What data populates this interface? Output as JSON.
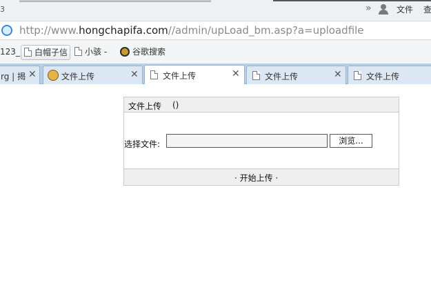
{
  "titlebar": {
    "left_text": "3",
    "overflow_chevron": "»",
    "menu_file": "文件",
    "menu_view": "查"
  },
  "address": {
    "prefix": "http://www.",
    "domain": "hongchapifa.com",
    "path": "//admin/upLoad_bm.asp?a=uploadfile"
  },
  "bookmarks": {
    "leading": "123_",
    "items": [
      {
        "label": "白帽子信",
        "icon": "page-icon"
      },
      {
        "label": "小骇 -",
        "icon": "page-icon"
      },
      {
        "label": "谷歌搜索",
        "icon": "paw-icon"
      }
    ]
  },
  "tabs": [
    {
      "label": "rg | 揭",
      "icon": "",
      "active": false
    },
    {
      "label": "文件上传",
      "icon": "face-icon",
      "active": false
    },
    {
      "label": "文件上传",
      "icon": "page-icon",
      "active": true
    },
    {
      "label": "文件上传",
      "icon": "page-icon",
      "active": false
    },
    {
      "label": "文件上传",
      "icon": "page-icon",
      "active": false
    }
  ],
  "tab_close_glyph": "✕",
  "upload": {
    "title": "文件上传",
    "paren": "()",
    "file_label": "选择文件:",
    "file_value": "",
    "browse_label": "浏览...",
    "submit_label": "· 开始上传 ·"
  }
}
